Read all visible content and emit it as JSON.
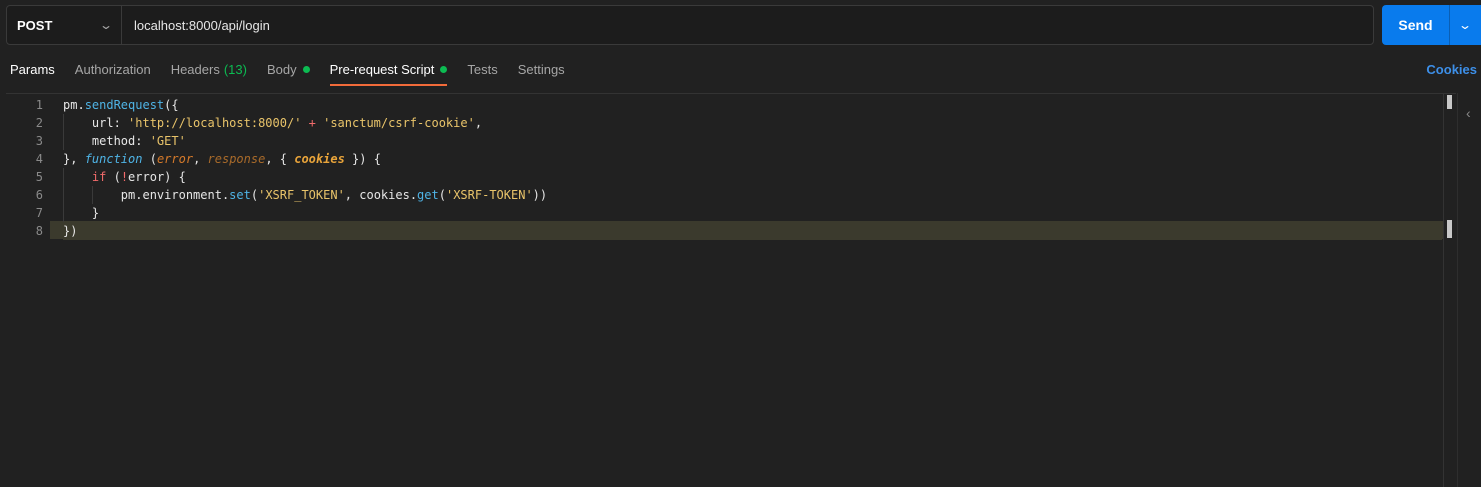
{
  "request": {
    "method": "POST",
    "url": "localhost:8000/api/login",
    "send_label": "Send"
  },
  "tabs": [
    {
      "label": "Params"
    },
    {
      "label": "Authorization"
    },
    {
      "label": "Headers",
      "count": "(13)"
    },
    {
      "label": "Body"
    },
    {
      "label": "Pre-request Script"
    },
    {
      "label": "Tests"
    },
    {
      "label": "Settings"
    }
  ],
  "cookies_label": "Cookies",
  "editor": {
    "line_numbers": [
      "1",
      "2",
      "3",
      "4",
      "5",
      "6",
      "7",
      "8"
    ],
    "current_line": 8
  },
  "colors": {
    "accent": "#097bed",
    "tab_underline": "#f26b3a",
    "status_dot": "#0cbb52",
    "link": "#3d8fe8"
  },
  "icons": {
    "method_dropdown": "chevron-down-icon",
    "send_dropdown": "chevron-down-icon",
    "panel_toggle": "chevron-left-icon"
  }
}
